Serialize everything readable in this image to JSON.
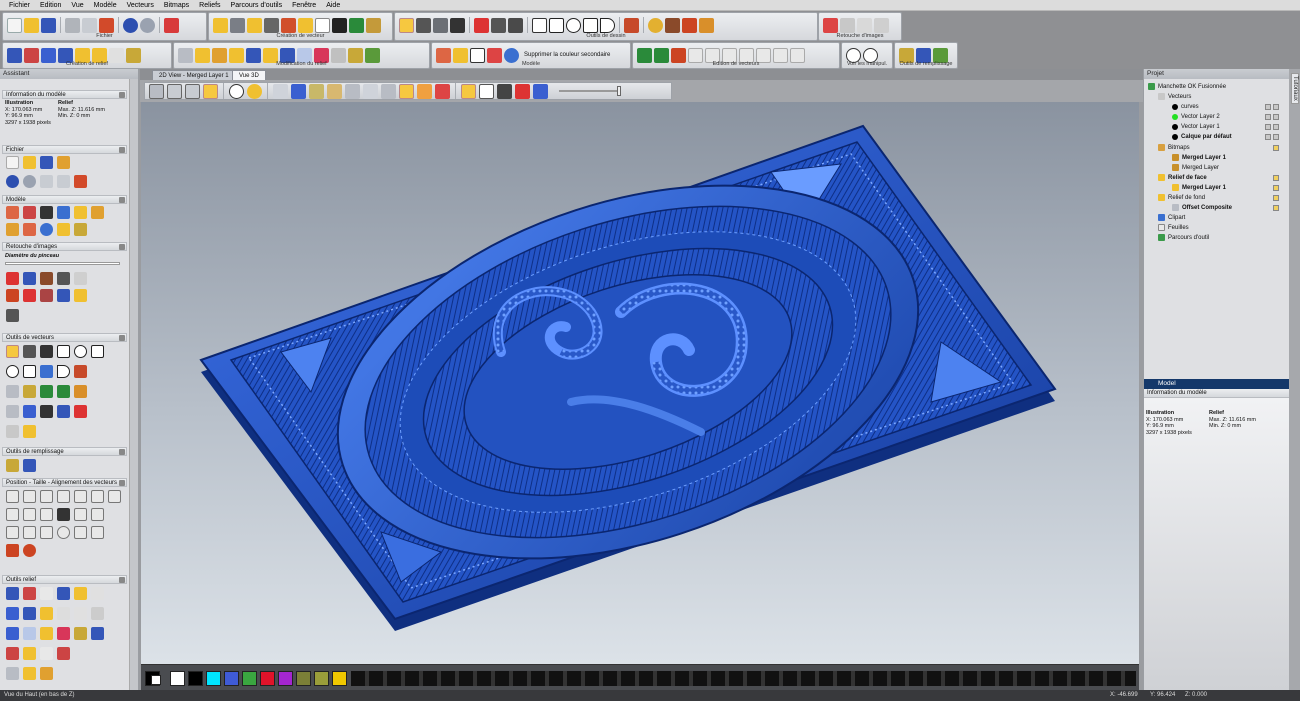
{
  "menu": [
    "Fichier",
    "Edition",
    "Vue",
    "Modèle",
    "Vecteurs",
    "Bitmaps",
    "Reliefs",
    "Parcours d'outils",
    "Fenêtre",
    "Aide"
  ],
  "toolbars": {
    "row1": [
      {
        "label": "Fichier"
      },
      {
        "label": "Création de vecteur"
      },
      {
        "label": "Outils de dessin"
      },
      {
        "label": "Retouche d'images"
      }
    ],
    "row2": [
      {
        "label": "Création de relief"
      },
      {
        "label": "Modification du relief"
      },
      {
        "label": "Modèle"
      },
      {
        "label": "Edition de vecteurs"
      },
      {
        "label": "Voir les manipul."
      },
      {
        "label": "Outils de remplissage"
      }
    ],
    "suppress_label": "Supprimer la couleur secondaire"
  },
  "left_panel": {
    "title": "Assistant",
    "info_header": "Information du modèle",
    "illustration_label": "Illustration",
    "relief_label": "Relief",
    "x": "X: 170.063 mm",
    "y": "Y: 96.9 mm",
    "pixels": "3297 x 1938 pixels",
    "maxz": "Max. Z: 11.616 mm",
    "minz": "Min. Z: 0 mm",
    "sections": {
      "fichier": "Fichier",
      "modele": "Modèle",
      "retouche": "Retouche d'images",
      "brush": "Diamètre du pinceau",
      "vecteurs": "Outils de vecteurs",
      "remplissage": "Outils de remplissage",
      "position": "Position - Taille - Alignement des vecteurs",
      "relief": "Outils relief"
    }
  },
  "tabs": {
    "view2d": "2D View - Merged Layer 1",
    "view3d": "Vue 3D"
  },
  "right_panel": {
    "title": "Projet",
    "root": "Manchette OK Fusionnée",
    "vecteurs": "Vecteurs",
    "curves": "curves",
    "vl2": "Vector Layer 2",
    "vl1": "Vector Layer 1",
    "calque": "Calque par défaut",
    "bitmaps": "Bitmaps",
    "ml1": "Merged Layer 1",
    "ml": "Merged Layer",
    "relief_face": "Relief de face",
    "ml1b": "Merged Layer 1",
    "relief_fond": "Relief de fond",
    "offset": "Offset Composite",
    "clipart": "Clipart",
    "feuilles": "Feuilles",
    "parcours": "Parcours d'outil",
    "side_tab": "Tutoriaux",
    "model_title": "Model",
    "model_sub": "Information du modèle"
  },
  "status": {
    "left": "Vue du Haut (en bas de Z)",
    "x": "X: -46.699",
    "y": "Y: 96.424",
    "z": "Z: 0.000"
  },
  "colors": {
    "accent": "#1b3a9e",
    "relief": "#1f4fb8",
    "palette": [
      "#ffffff",
      "#000000",
      "#00e5ff",
      "#3f5bd6",
      "#3aa640",
      "#e0132a",
      "#a426d0",
      "#7b7f37",
      "#f0c800"
    ]
  }
}
